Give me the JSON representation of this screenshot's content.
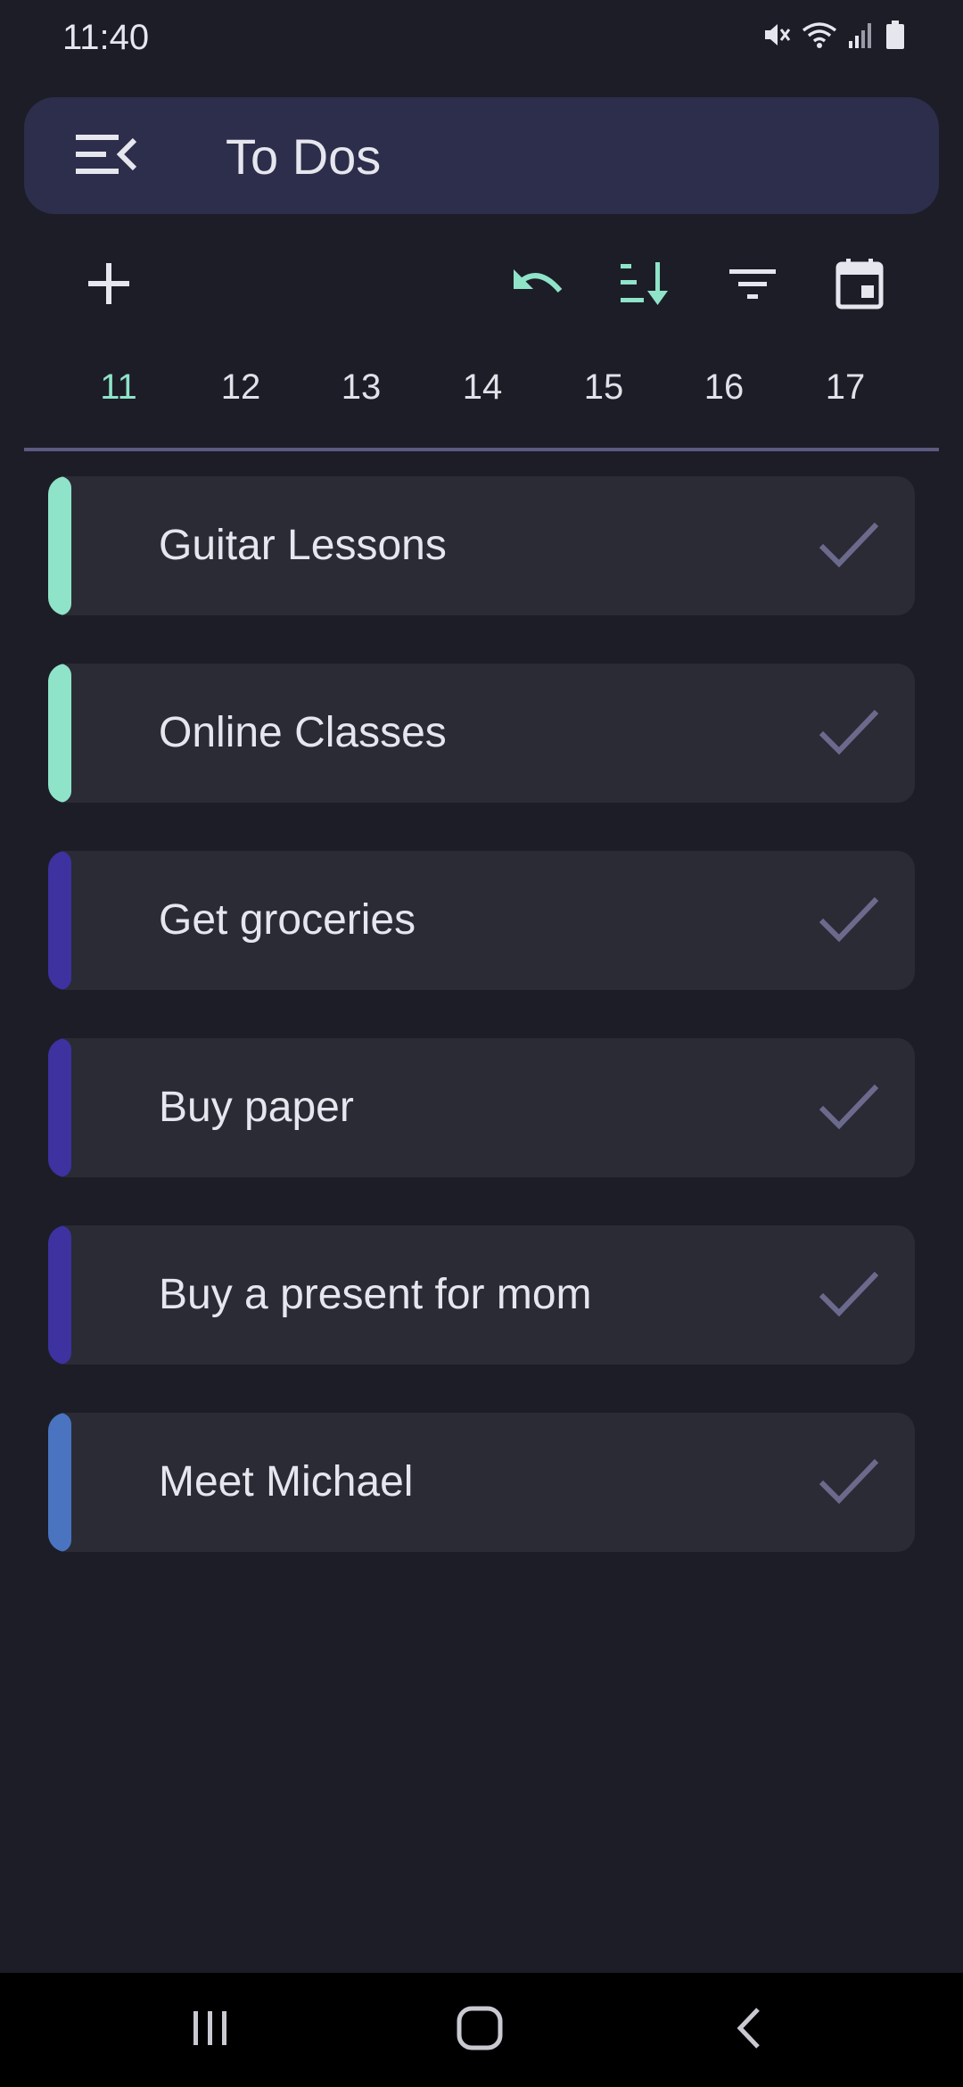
{
  "status_bar": {
    "time": "11:40",
    "icons": [
      "mute-icon",
      "wifi-icon",
      "signal-icon",
      "battery-icon"
    ]
  },
  "app_bar": {
    "title": "To Dos",
    "menu_icon": "menu-collapse-icon"
  },
  "toolbar": {
    "actions": [
      "add-icon",
      "undo-icon",
      "sort-icon",
      "filter-icon",
      "calendar-icon"
    ]
  },
  "days": {
    "items": [
      "11",
      "12",
      "13",
      "14",
      "15",
      "16",
      "17"
    ],
    "selected": "11"
  },
  "tasks": [
    {
      "title": "Guitar Lessons",
      "color": "#8fe3c8"
    },
    {
      "title": "Online Classes",
      "color": "#8fe3c8"
    },
    {
      "title": "Get groceries",
      "color": "#3d32a0"
    },
    {
      "title": "Buy paper",
      "color": "#3d32a0"
    },
    {
      "title": "Buy a present for mom",
      "color": "#3d32a0"
    },
    {
      "title": "Meet Michael",
      "color": "#4a74c0"
    }
  ],
  "colors": {
    "background": "#1d1d28",
    "app_bar": "#2d2d4c",
    "accent": "#8fe3c8",
    "card": "#2b2b36",
    "check": "#6c6a8c"
  },
  "nav_bar": {
    "icons": [
      "recents-icon",
      "home-icon",
      "back-icon"
    ]
  }
}
